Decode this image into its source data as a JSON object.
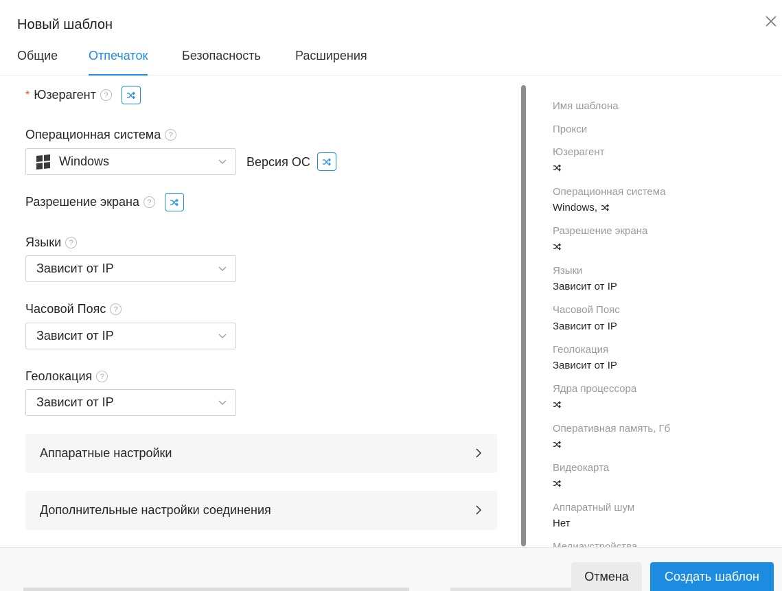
{
  "modal": {
    "title": "Новый шаблон"
  },
  "tabs": [
    {
      "label": "Общие"
    },
    {
      "label": "Отпечаток"
    },
    {
      "label": "Безопасность"
    },
    {
      "label": "Расширения"
    }
  ],
  "form": {
    "useragent": {
      "required_mark": "*",
      "label": "Юзерагент"
    },
    "os": {
      "label": "Операционная система",
      "value": "Windows",
      "version_label": "Версия ОС"
    },
    "screen": {
      "label": "Разрешение экрана"
    },
    "languages": {
      "label": "Языки",
      "value": "Зависит от IP"
    },
    "timezone": {
      "label": "Часовой Пояс",
      "value": "Зависит от IP"
    },
    "geolocation": {
      "label": "Геолокация",
      "value": "Зависит от IP"
    },
    "help_glyph": "?",
    "sections": [
      {
        "label": "Аппаратные настройки"
      },
      {
        "label": "Дополнительные настройки соединения"
      }
    ]
  },
  "summary": {
    "items": [
      {
        "label": "Имя шаблона"
      },
      {
        "label": "Прокси"
      },
      {
        "label": "Юзерагент",
        "shuffle": true
      },
      {
        "label": "Операционная система",
        "value": "Windows,",
        "shuffle": true
      },
      {
        "label": "Разрешение экрана",
        "shuffle": true
      },
      {
        "label": "Языки",
        "value": "Зависит от IP"
      },
      {
        "label": "Часовой Пояс",
        "value": "Зависит от IP"
      },
      {
        "label": "Геолокация",
        "value": "Зависит от IP"
      },
      {
        "label": "Ядра процессора",
        "shuffle": true
      },
      {
        "label": "Оперативная память, Гб",
        "shuffle": true
      },
      {
        "label": "Видеокарта",
        "shuffle": true
      },
      {
        "label": "Аппаратный шум",
        "value": "Нет"
      },
      {
        "label": "Медиаустройства"
      }
    ]
  },
  "footer": {
    "cancel_label": "Отмена",
    "create_label": "Создать шаблон"
  },
  "colors": {
    "accent": "#1c8ce0",
    "required": "#e5533d"
  }
}
